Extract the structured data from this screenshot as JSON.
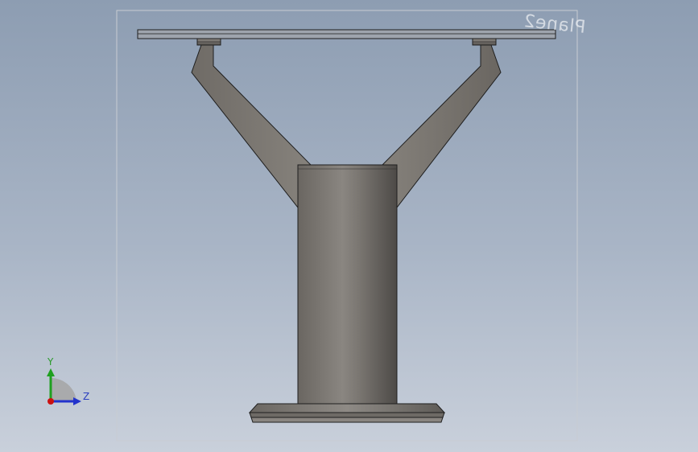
{
  "viewport": {
    "plane_label": "Plane2",
    "colors": {
      "background_top": "#8d9db2",
      "background_bottom": "#c9d0db",
      "part_body": "#7b7772",
      "part_edge": "#1e1e1e"
    }
  },
  "triad": {
    "y_label": "Y",
    "z_label": "Z",
    "colors": {
      "y": "#1fa01f",
      "z": "#2233cc",
      "x": "#cc1111"
    }
  }
}
